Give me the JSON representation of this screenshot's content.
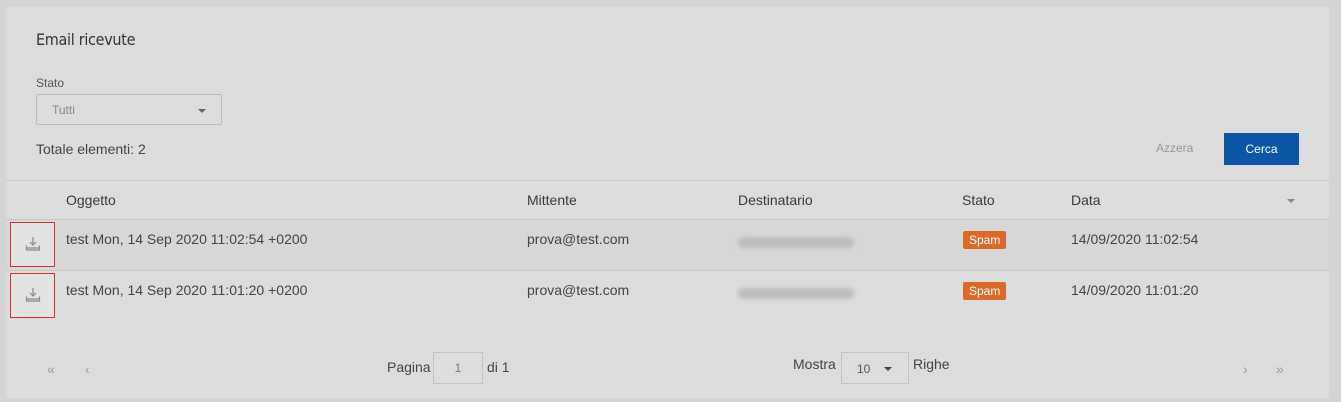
{
  "header": {
    "title": "Email ricevute"
  },
  "filter": {
    "stato_label": "Stato",
    "stato_value": "Tutti"
  },
  "summary": {
    "totale": "Totale elementi: 2"
  },
  "actions": {
    "azzera": "Azzera",
    "cerca": "Cerca"
  },
  "table": {
    "columns": [
      "Oggetto",
      "Mittente",
      "Destinatario",
      "Stato",
      "Data"
    ],
    "rows": [
      {
        "oggetto": "test Mon, 14 Sep 2020 11:02:54 +0200",
        "mittente": "prova@test.com",
        "stato": "Spam",
        "data": "14/09/2020 11:02:54"
      },
      {
        "oggetto": "test Mon, 14 Sep 2020 11:01:20 +0200",
        "mittente": "prova@test.com",
        "stato": "Spam",
        "data": "14/09/2020 11:01:20"
      }
    ]
  },
  "pagination": {
    "first": "«",
    "prev": "‹",
    "next": "›",
    "last": "»",
    "pagina_label": "Pagina",
    "page_value": "1",
    "di_label": "di 1",
    "mostra_label": "Mostra",
    "rows_value": "10",
    "righe_label": "Righe"
  },
  "colors": {
    "primary": "#0b56a5",
    "spam": "#d96a2b",
    "download_border": "#d32f2f"
  }
}
